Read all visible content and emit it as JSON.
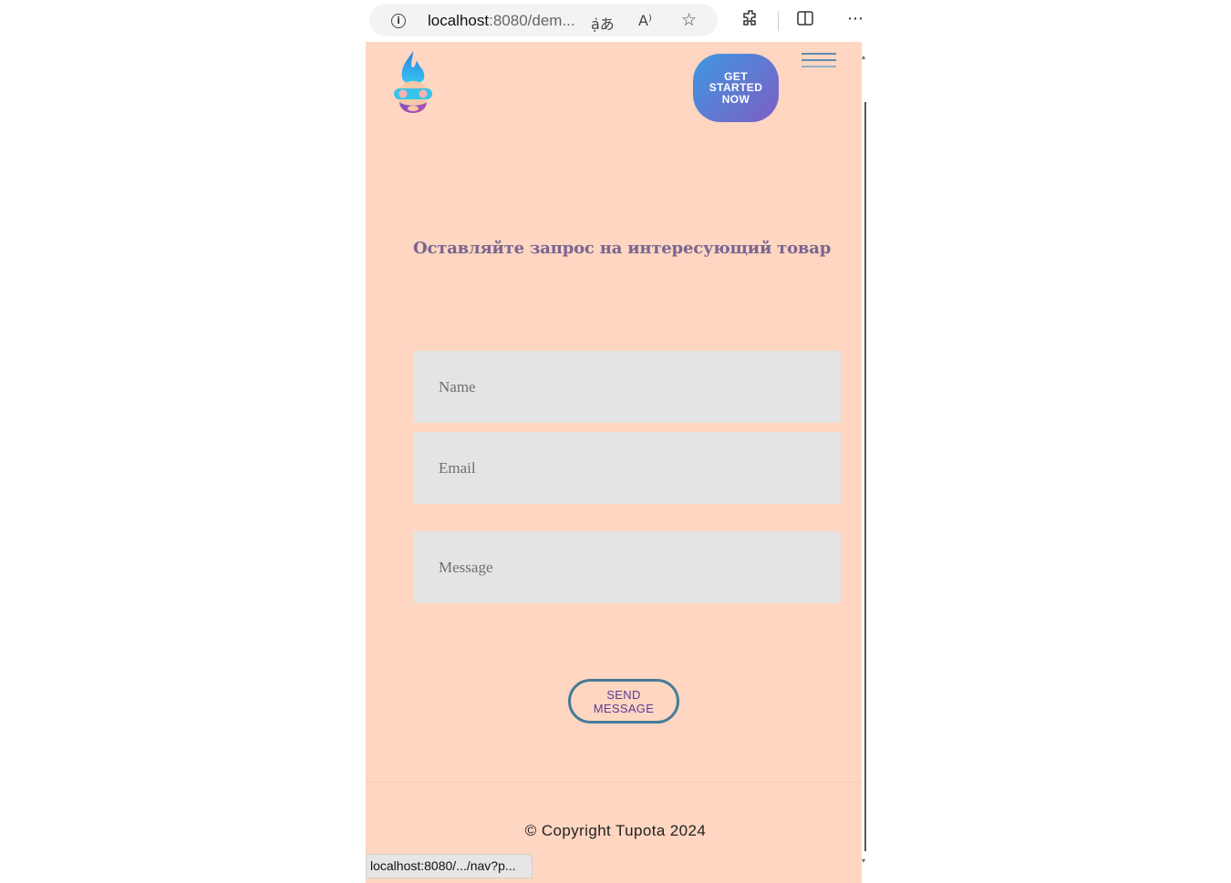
{
  "browser": {
    "url_host": "localhost",
    "url_rest": ":8080/dem...",
    "icons": [
      "info-icon",
      "translate-icon",
      "read-aloud-icon",
      "favorite-star-icon",
      "extensions-icon",
      "split-screen-icon",
      "more-options-icon"
    ],
    "status_url": "localhost:8080/.../nav?p..."
  },
  "header": {
    "logo": "flame-gamer-mascot-logo",
    "cta_label": "GET STARTED NOW",
    "menu_icon": "hamburger-menu-icon"
  },
  "form": {
    "heading": "Оставляйте запрос на интересующий товар",
    "name_placeholder": "Name",
    "email_placeholder": "Email",
    "message_placeholder": "Message",
    "submit_label": "SEND MESSAGE"
  },
  "footer": {
    "copyright": "© Copyright Tupota 2024"
  },
  "colors": {
    "page_background": "#fed6c1",
    "heading": "#7a6591",
    "field_background": "#e4e4e4",
    "cta_gradient_start": "#3f97e0",
    "cta_gradient_end": "#7d5ec4",
    "send_border": "#467b99",
    "send_text": "#5b3b96"
  }
}
